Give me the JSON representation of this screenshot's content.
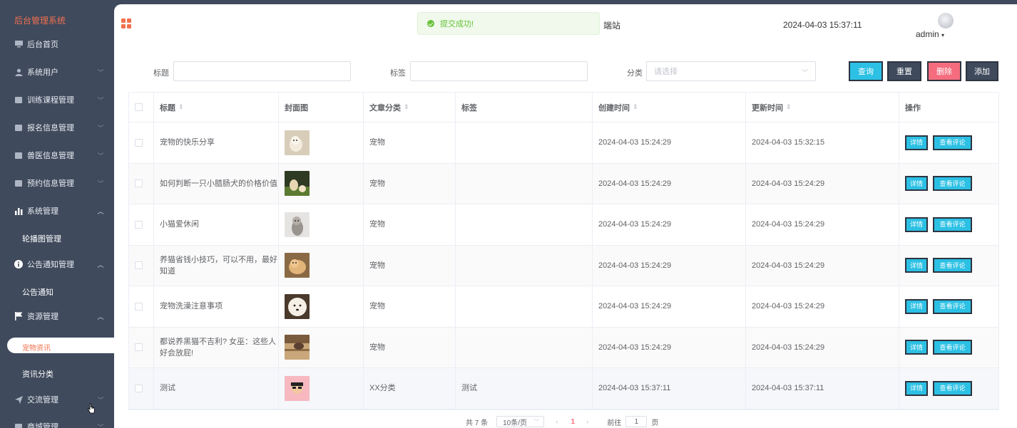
{
  "app": {
    "brand": "后台管理系统"
  },
  "sidebar": {
    "items": [
      {
        "label": "后台首页",
        "icon": "monitor-icon",
        "chevron": ""
      },
      {
        "label": "系统用户",
        "icon": "user-icon",
        "chevron": "down"
      },
      {
        "label": "训练课程管理",
        "icon": "square-icon",
        "chevron": "down"
      },
      {
        "label": "报名信息管理",
        "icon": "square-icon",
        "chevron": "down"
      },
      {
        "label": "兽医信息管理",
        "icon": "square-icon",
        "chevron": "down"
      },
      {
        "label": "预约信息管理",
        "icon": "square-icon",
        "chevron": "down"
      },
      {
        "label": "系统管理",
        "icon": "bar-chart-icon",
        "chevron": "up"
      },
      {
        "label": "公告通知管理",
        "icon": "info-icon",
        "chevron": "up"
      },
      {
        "label": "资源管理",
        "icon": "flag-icon",
        "chevron": "up"
      },
      {
        "label": "交流管理",
        "icon": "send-icon",
        "chevron": "down"
      },
      {
        "label": "商城管理",
        "icon": "square-icon",
        "chevron": "down"
      }
    ],
    "sub_items": {
      "carousel": "轮播图管理",
      "notice": "公告通知",
      "pet_news": "宠物资讯",
      "news_category": "资讯分类"
    }
  },
  "header": {
    "toast": "提交成功!",
    "site_title": "端站",
    "datetime": "2024-04-03 15:37:11",
    "user": "admin"
  },
  "filters": {
    "title_label": "标题",
    "tag_label": "标签",
    "category_label": "分类",
    "category_placeholder": "请选择",
    "btn_query": "查询",
    "btn_reset": "重置",
    "btn_delete": "删除",
    "btn_add": "添加"
  },
  "table": {
    "headers": {
      "title": "标题",
      "cover": "封面图",
      "category": "文章分类",
      "tag": "标签",
      "created": "创建时间",
      "updated": "更新时间",
      "ops": "操作"
    },
    "op_detail": "详情",
    "op_comments": "查看评论",
    "rows": [
      {
        "title": "宠物的快乐分享",
        "category": "宠物",
        "tag": "",
        "created": "2024-04-03 15:24:29",
        "updated": "2024-04-03 15:32:15"
      },
      {
        "title": "如何判断一只小腊肠犬的价格价值",
        "category": "宠物",
        "tag": "",
        "created": "2024-04-03 15:24:29",
        "updated": "2024-04-03 15:24:29"
      },
      {
        "title": "小猫爱休闲",
        "category": "宠物",
        "tag": "",
        "created": "2024-04-03 15:24:29",
        "updated": "2024-04-03 15:24:29"
      },
      {
        "title": "养猫省钱小技巧，可以不用，最好知道",
        "category": "宠物",
        "tag": "",
        "created": "2024-04-03 15:24:29",
        "updated": "2024-04-03 15:24:29"
      },
      {
        "title": "宠物洗澡注意事项",
        "category": "宠物",
        "tag": "",
        "created": "2024-04-03 15:24:29",
        "updated": "2024-04-03 15:24:29"
      },
      {
        "title": "都说养黑猫不吉利? 女巫：这些人好会放屁!",
        "category": "宠物",
        "tag": "",
        "created": "2024-04-03 15:24:29",
        "updated": "2024-04-03 15:24:29"
      },
      {
        "title": "测试",
        "category": "XX分类",
        "tag": "测试",
        "created": "2024-04-03 15:37:11",
        "updated": "2024-04-03 15:37:11"
      }
    ]
  },
  "pagination": {
    "total": "共 7 条",
    "page_size": "10条/页",
    "current": "1",
    "goto_label": "前往",
    "goto_value": "1",
    "page_unit": "页"
  },
  "colors": {
    "accent": "#f0704f",
    "sidebar": "#3f4a5c",
    "button": "#2bc0e4",
    "danger": "#f56c7e",
    "success": "#67c23a"
  }
}
